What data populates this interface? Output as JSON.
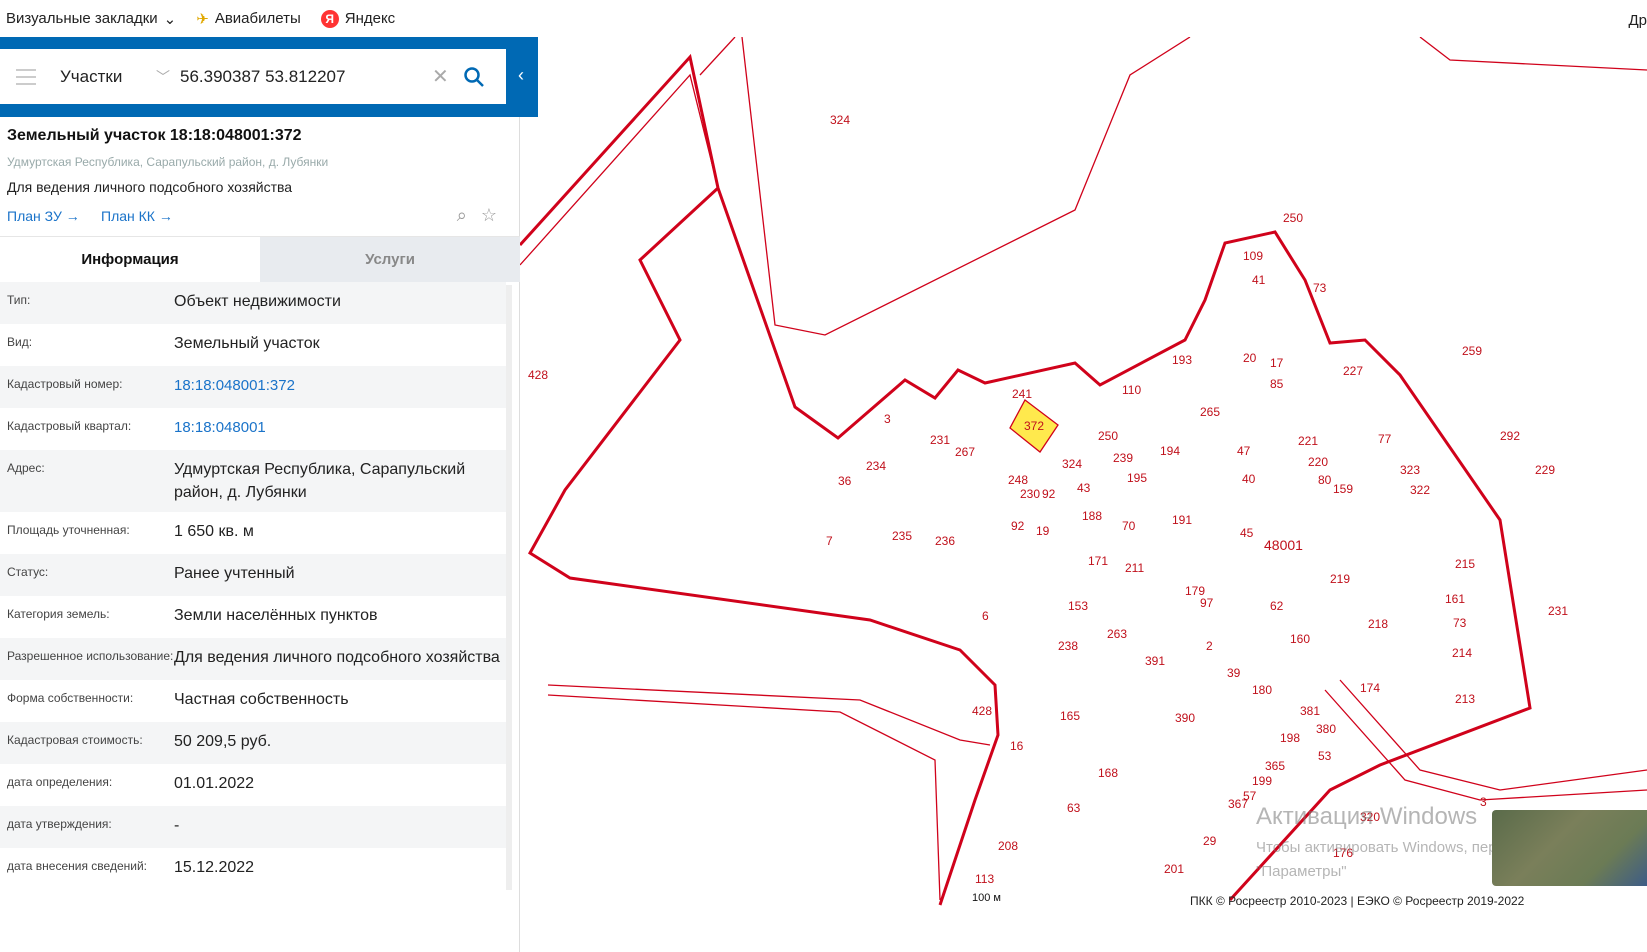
{
  "bookmarks": {
    "items": [
      {
        "label": "Визуальные закладки"
      },
      {
        "label": "Авиабилеты"
      },
      {
        "label": "Яндекс"
      }
    ],
    "overflow": "Др"
  },
  "search": {
    "layer": "Участки",
    "value": "56.390387 53.812207"
  },
  "object": {
    "title": "Земельный участок 18:18:048001:372",
    "address": "Удмуртская Республика, Сарапульский район, д. Лубянки",
    "purpose": "Для ведения личного подсобного хозяйства",
    "plan_zu": "План ЗУ",
    "plan_kk": "План КК"
  },
  "tabs": [
    {
      "label": "Информация"
    },
    {
      "label": "Услуги"
    }
  ],
  "rows": [
    {
      "label": "Тип:",
      "value": "Объект недвижимости"
    },
    {
      "label": "Вид:",
      "value": "Земельный участок"
    },
    {
      "label": "Кадастровый номер:",
      "value": "18:18:048001:372",
      "link": true
    },
    {
      "label": "Кадастровый квартал:",
      "value": "18:18:048001",
      "link": true
    },
    {
      "label": "Адрес:",
      "value": "Удмуртская Республика, Сарапульский район, д. Лубянки"
    },
    {
      "label": "Площадь уточненная:",
      "value": "1 650 кв. м"
    },
    {
      "label": "Статус:",
      "value": "Ранее учтенный"
    },
    {
      "label": "Категория земель:",
      "value": "Земли населённых пунктов"
    },
    {
      "label": "Разрешенное использование:",
      "value": "Для ведения личного подсобного хозяйства"
    },
    {
      "label": "Форма собственности:",
      "value": "Частная собственность"
    },
    {
      "label": "Кадастровая стоимость:",
      "value": "50 209,5 руб."
    },
    {
      "label": "дата определения:",
      "value": "01.01.2022"
    },
    {
      "label": "дата утверждения:",
      "value": "-"
    },
    {
      "label": "дата внесения сведений:",
      "value": "15.12.2022"
    }
  ],
  "map": {
    "quarter": "48001",
    "labels": [
      "324",
      "428",
      "250",
      "109",
      "41",
      "73",
      "193",
      "20",
      "17",
      "85",
      "110",
      "241",
      "372",
      "265",
      "227",
      "259",
      "3",
      "231",
      "267",
      "250",
      "239",
      "194",
      "47",
      "221",
      "220",
      "80",
      "159",
      "77",
      "323",
      "322",
      "292",
      "229",
      "36",
      "234",
      "248",
      "230",
      "92",
      "324",
      "43",
      "195",
      "40",
      "188",
      "70",
      "191",
      "45",
      "7",
      "235",
      "236",
      "92",
      "19",
      "171",
      "211",
      "219",
      "215",
      "161",
      "73",
      "214",
      "213",
      "6",
      "153",
      "263",
      "179",
      "97",
      "62",
      "160",
      "218",
      "238",
      "391",
      "2",
      "39",
      "180",
      "174",
      "428",
      "165",
      "16",
      "390",
      "381",
      "198",
      "380",
      "53",
      "365",
      "199",
      "57",
      "367",
      "168",
      "63",
      "208",
      "29",
      "201",
      "176",
      "320",
      "3",
      "113",
      "231"
    ],
    "scale": "100 м",
    "copyright": "ПКК © Росреестр 2010-2023 | ЕЭКО © Росреестр 2019-2022"
  },
  "watermark": {
    "title": "Активация Windows",
    "line1": "Чтобы активировать Windows, перейдите",
    "line2": "\"Параметры\""
  },
  "colors": {
    "accent": "#0069b4",
    "parcel": "#d0021b",
    "selected": "#ffe94d"
  }
}
